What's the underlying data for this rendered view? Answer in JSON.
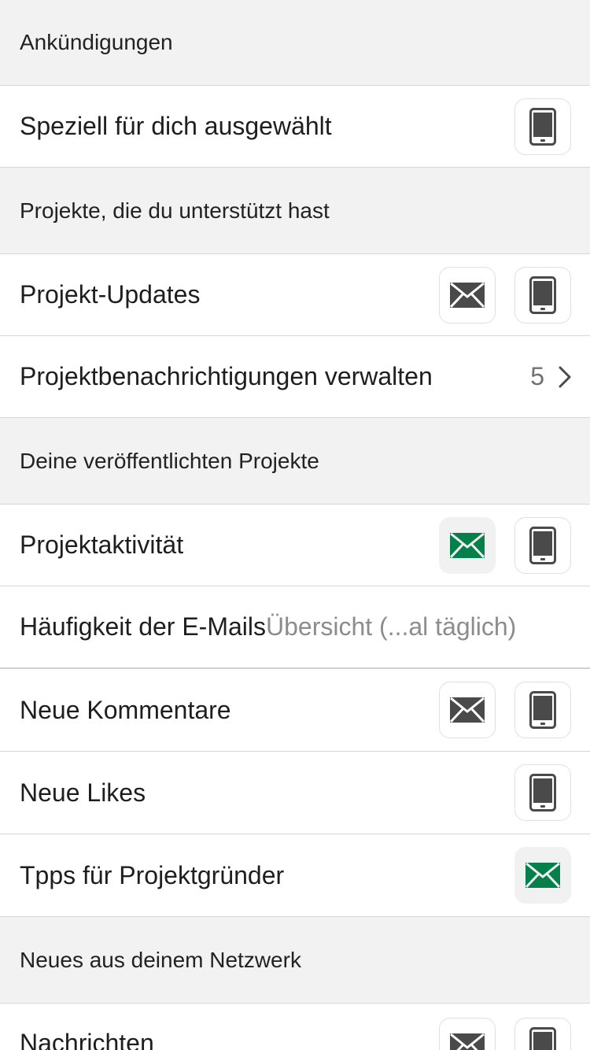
{
  "sections": {
    "announcements": {
      "header": "Ankündigungen",
      "special": "Speziell für dich ausgewählt"
    },
    "backed": {
      "header": "Projekte, die du unterstützt hast",
      "updates": "Projekt-Updates",
      "manage": "Projektbenachrichtigungen verwalten",
      "manage_count": "5"
    },
    "published": {
      "header": "Deine veröffentlichten Projekte",
      "activity": "Projektaktivität",
      "frequency": "Häufigkeit der E-Mails",
      "frequency_value": "Übersicht (...al täglich)",
      "comments": "Neue Kommentare",
      "likes": "Neue Likes",
      "tips": "Tpps für Projektgründer"
    },
    "network": {
      "header": "Neues aus deinem Netzwerk",
      "messages": "Nachrichten"
    }
  },
  "colors": {
    "email_active": "#05804a",
    "icon_inactive": "#4a4a4a"
  },
  "icons": {
    "email": "envelope-icon",
    "phone": "phone-icon",
    "chevron": "chevron-right-icon"
  }
}
